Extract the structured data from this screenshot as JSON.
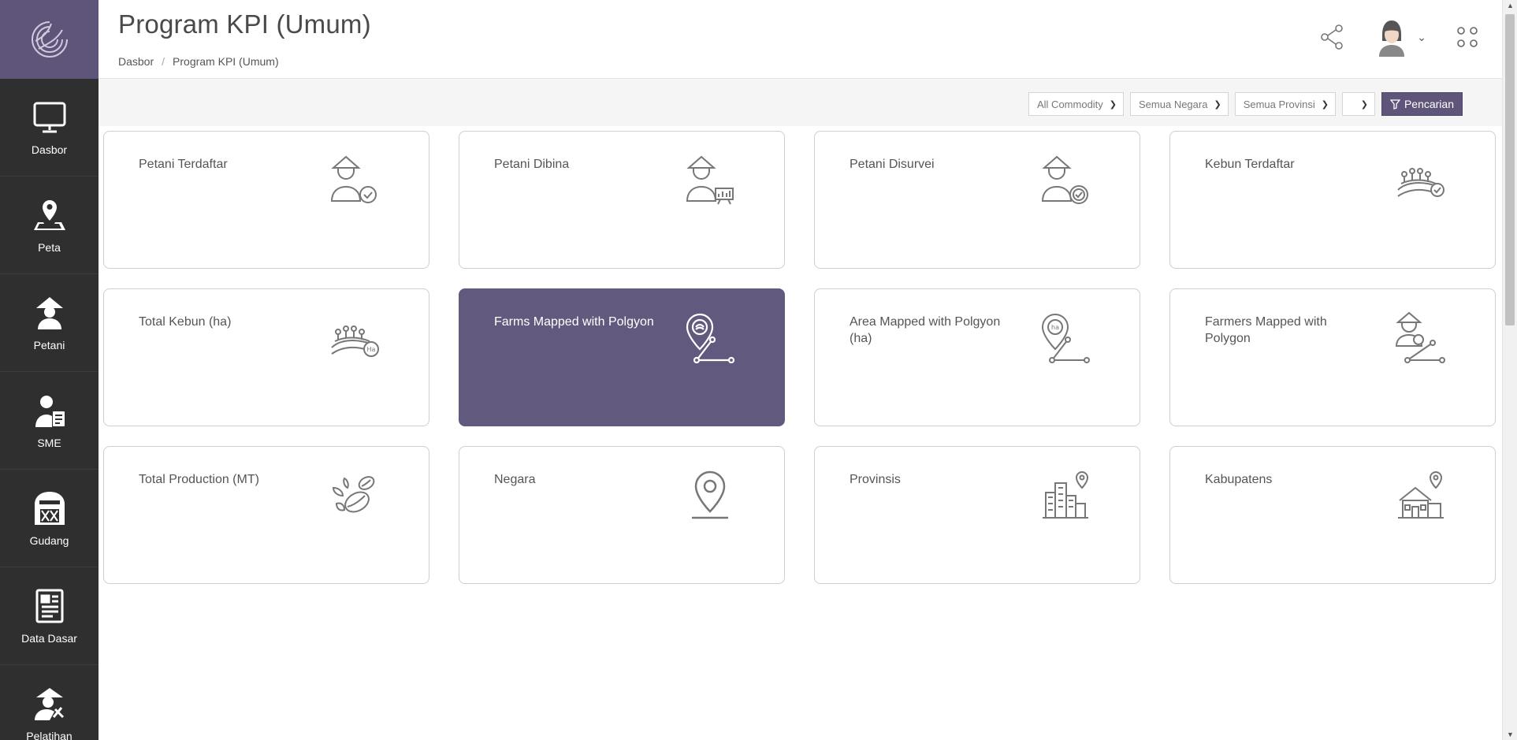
{
  "page": {
    "title": "Program KPI (Umum)"
  },
  "breadcrumb": {
    "home": "Dasbor",
    "separator": "/",
    "current": "Program KPI (Umum)"
  },
  "sidebar": {
    "logo_icon": "wheat-swirl-logo",
    "items": [
      {
        "label": "Dasbor",
        "icon": "monitor-icon"
      },
      {
        "label": "Peta",
        "icon": "map-pin-icon"
      },
      {
        "label": "Petani",
        "icon": "farmer-icon"
      },
      {
        "label": "SME",
        "icon": "sme-icon"
      },
      {
        "label": "Gudang",
        "icon": "warehouse-icon"
      },
      {
        "label": "Data Dasar",
        "icon": "document-icon"
      },
      {
        "label": "Pelatihan",
        "icon": "training-icon"
      }
    ]
  },
  "header": {
    "share_icon": "share-icon",
    "avatar_icon": "avatar-icon",
    "apps_icon": "apps-grid-icon"
  },
  "filters": {
    "commodity": "All Commodity",
    "country": "Semua Negara",
    "province": "Semua Provinsi",
    "extra": "",
    "search_label": "Pencarian"
  },
  "cards": [
    {
      "label": "Petani Terdaftar",
      "icon": "farmer-check-icon"
    },
    {
      "label": "Petani Dibina",
      "icon": "farmer-chart-icon"
    },
    {
      "label": "Petani Disurvei",
      "icon": "farmer-survey-icon"
    },
    {
      "label": "Kebun Terdaftar",
      "icon": "field-check-icon"
    },
    {
      "label": "Total Kebun (ha)",
      "icon": "field-ha-icon"
    },
    {
      "label": "Farms Mapped with Polgyon",
      "icon": "pin-polygon-icon",
      "active": true
    },
    {
      "label": "Area Mapped with Polgyon (ha)",
      "icon": "pin-polygon-ha-icon"
    },
    {
      "label": "Farmers Mapped with Polygon",
      "icon": "farmer-polygon-icon"
    },
    {
      "label": "Total Production (MT)",
      "icon": "beans-icon"
    },
    {
      "label": "Negara",
      "icon": "location-pin-icon"
    },
    {
      "label": "Provinsis",
      "icon": "city-pin-icon"
    },
    {
      "label": "Kabupatens",
      "icon": "house-pin-icon"
    }
  ],
  "colors": {
    "sidebar": "#2f2f2f",
    "brand": "#5f5479",
    "active_card": "#625a7e"
  }
}
